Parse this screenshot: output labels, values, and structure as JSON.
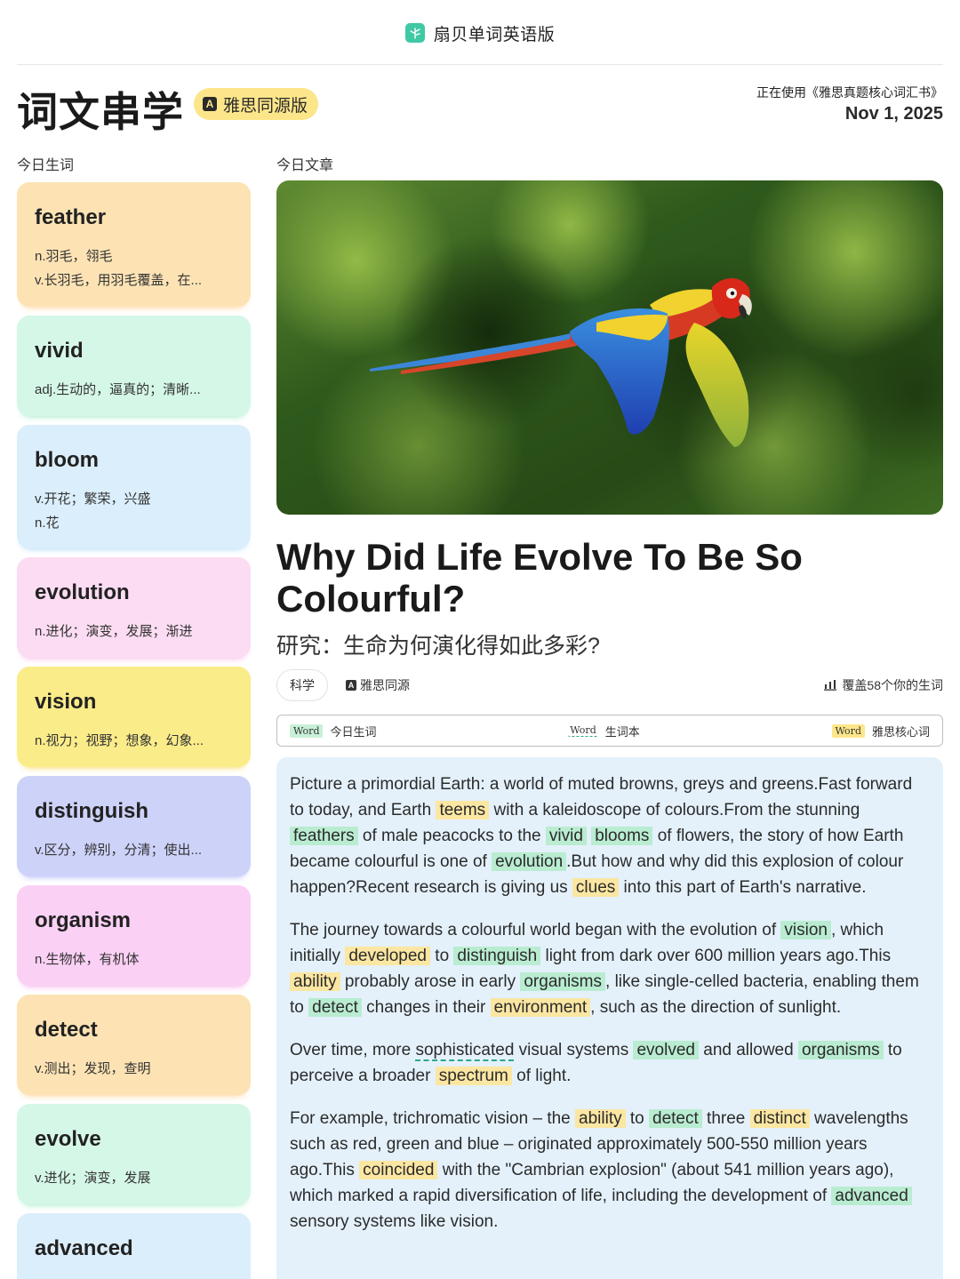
{
  "app": {
    "title": "扇贝单词英语版",
    "icon": "shanbay-leaf-icon"
  },
  "header": {
    "title": "词文串学",
    "badge": "雅思同源版",
    "badge_icon": "A",
    "using_book": "正在使用《雅思真题核心词汇书》",
    "date": "Nov 1, 2025"
  },
  "sections": {
    "words_label": "今日生词",
    "article_label": "今日文章"
  },
  "words": [
    {
      "word": "feather",
      "defs": [
        "n.羽毛，翎毛",
        "v.长羽毛，用羽毛覆盖，在..."
      ],
      "color": "#fde3b4",
      "glow": "#ffc978"
    },
    {
      "word": "vivid",
      "defs": [
        "adj.生动的，逼真的；清晰..."
      ],
      "color": "#d5f7e7",
      "glow": "#8fe6bd"
    },
    {
      "word": "bloom",
      "defs": [
        "v.开花；繁荣，兴盛",
        "n.花"
      ],
      "color": "#dbeefb",
      "glow": "#9fd0f4"
    },
    {
      "word": "evolution",
      "defs": [
        "n.进化；演变，发展；渐进"
      ],
      "color": "#fbdcf2",
      "glow": "#f5a8dc"
    },
    {
      "word": "vision",
      "defs": [
        "n.视力；视野；想象，幻象..."
      ],
      "color": "#fbec8a",
      "glow": "#f5d54a"
    },
    {
      "word": "distinguish",
      "defs": [
        "v.区分，辨别，分清；使出..."
      ],
      "color": "#cdd2f9",
      "glow": "#a2abf2"
    },
    {
      "word": "organism",
      "defs": [
        "n.生物体，有机体"
      ],
      "color": "#fbd0f5",
      "glow": "#f29be5"
    },
    {
      "word": "detect",
      "defs": [
        "v.测出；发现，查明"
      ],
      "color": "#fde3b4",
      "glow": "#ffc978"
    },
    {
      "word": "evolve",
      "defs": [
        "v.进化；演变，发展"
      ],
      "color": "#d5f7e7",
      "glow": "#8fe6bd"
    },
    {
      "word": "advanced",
      "defs": [],
      "color": "#dbeefb",
      "glow": "#9fd0f4"
    }
  ],
  "article": {
    "title": "Why Did Life Evolve To Be So Colourful?",
    "subtitle": "研究：生命为何演化得如此多彩?",
    "tag": "科学",
    "source": "雅思同源",
    "coverage": "覆盖58个你的生词",
    "legend": [
      {
        "word": "Word",
        "label": "今日生词"
      },
      {
        "word": "Word",
        "label": "生词本"
      },
      {
        "word": "Word",
        "label": "雅思核心词"
      }
    ],
    "paragraphs": [
      [
        [
          "t",
          "Picture a primordial Earth: a world of muted browns, greys and greens.Fast forward to today, and Earth "
        ],
        [
          "y",
          "teems"
        ],
        [
          "t",
          " with a kaleidoscope of colours.From the stunning "
        ],
        [
          "g",
          "feathers"
        ],
        [
          "t",
          " of male peacocks to the "
        ],
        [
          "g",
          "vivid"
        ],
        [
          "t",
          " "
        ],
        [
          "g",
          "blooms"
        ],
        [
          "t",
          " of flowers, the story of how Earth became colourful is one of "
        ],
        [
          "g",
          "evolution"
        ],
        [
          "t",
          ".But how and why did this explosion of colour happen?Recent research is giving us "
        ],
        [
          "y",
          "clues"
        ],
        [
          "t",
          " into this part of Earth's narrative."
        ]
      ],
      [
        [
          "t",
          "The journey towards a colourful world began with the evolution of "
        ],
        [
          "g",
          "vision"
        ],
        [
          "t",
          ", which initially "
        ],
        [
          "y",
          "developed"
        ],
        [
          "t",
          " to "
        ],
        [
          "g",
          "distinguish"
        ],
        [
          "t",
          " light from dark over 600 million years ago.This "
        ],
        [
          "y",
          "ability"
        ],
        [
          "t",
          " probably arose in early "
        ],
        [
          "g",
          "organisms"
        ],
        [
          "t",
          ", like single-celled bacteria, enabling them to "
        ],
        [
          "g",
          "detect"
        ],
        [
          "t",
          " changes in their "
        ],
        [
          "y",
          "environment"
        ],
        [
          "t",
          ", such as the direction of sunlight."
        ]
      ],
      [
        [
          "t",
          "Over time, more "
        ],
        [
          "d",
          "sophisticated"
        ],
        [
          "t",
          " visual systems "
        ],
        [
          "g",
          "evolved"
        ],
        [
          "t",
          " and allowed "
        ],
        [
          "g",
          "organisms"
        ],
        [
          "t",
          " to perceive a broader "
        ],
        [
          "y",
          "spectrum"
        ],
        [
          "t",
          " of light."
        ]
      ],
      [
        [
          "t",
          "For example, trichromatic vision – the "
        ],
        [
          "y",
          "ability"
        ],
        [
          "t",
          " to "
        ],
        [
          "g",
          "detect"
        ],
        [
          "t",
          " three "
        ],
        [
          "y",
          "distinct"
        ],
        [
          "t",
          " wavelengths such as red, green and blue – originated approximately 500-550 million years ago.This "
        ],
        [
          "y",
          "coincided"
        ],
        [
          "t",
          " with the \"Cambrian explosion\" (about 541 million years ago), which marked a rapid diversification of life, including the development of "
        ],
        [
          "g",
          "advanced"
        ],
        [
          "t",
          " sensory systems like vision."
        ]
      ]
    ]
  }
}
